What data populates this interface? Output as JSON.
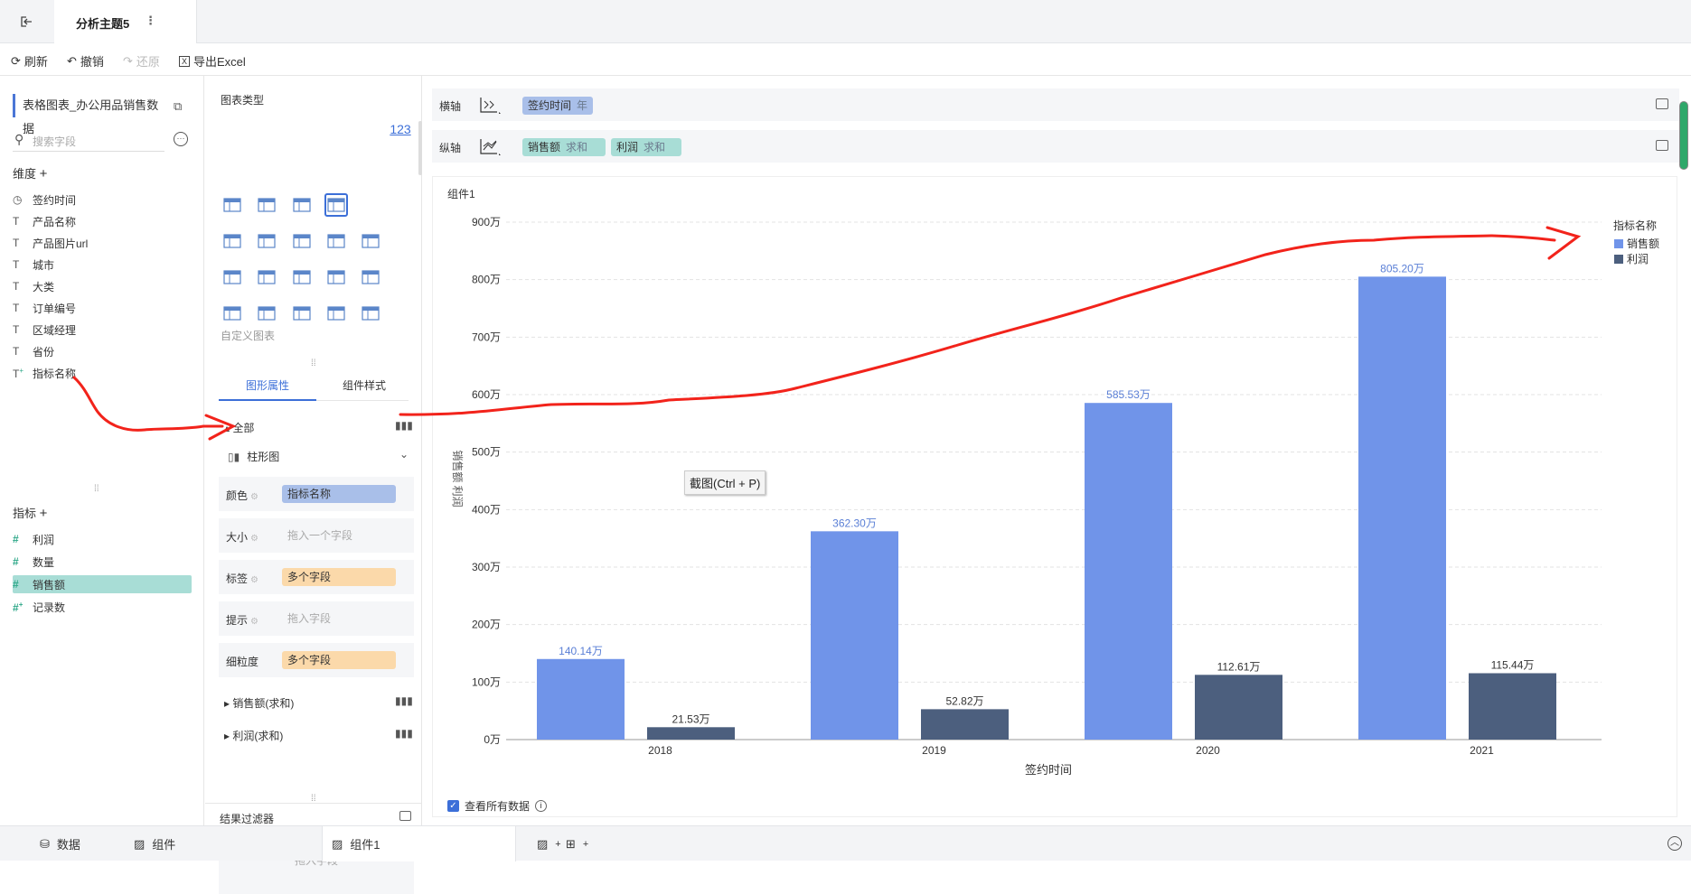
{
  "titlebar": {
    "tab_title": "分析主题5",
    "more": "⋮"
  },
  "toolbar": {
    "refresh": "刷新",
    "undo": "撤销",
    "redo": "还原",
    "export": "导出Excel"
  },
  "left": {
    "dataset": "表格图表_办公用品销售数据",
    "search_placeholder": "搜索字段",
    "dim_header": "维度",
    "dimensions": [
      "签约时间",
      "产品名称",
      "产品图片url",
      "城市",
      "大类",
      "订单编号",
      "区域经理",
      "省份",
      "指标名称"
    ],
    "measure_header": "指标",
    "measures": [
      "利润",
      "数量",
      "销售额",
      "记录数"
    ]
  },
  "mid": {
    "chart_type_label": "图表类型",
    "numeric_icon": "123",
    "custom_chart": "自定义图表",
    "tab_props": "图形属性",
    "tab_style": "组件样式",
    "all": "全部",
    "bar_type": "柱形图",
    "color_lbl": "颜色",
    "color_val": "指标名称",
    "size_lbl": "大小",
    "size_val": "拖入一个字段",
    "label_lbl": "标签",
    "label_val": "多个字段",
    "tip_lbl": "提示",
    "tip_val": "拖入字段",
    "gran_lbl": "细粒度",
    "gran_val": "多个字段",
    "exp1": "销售额(求和)",
    "exp2": "利润(求和)",
    "filter_title": "结果过滤器",
    "filter_ph": "拖入字段"
  },
  "shelves": {
    "x_label": "横轴",
    "x_chip": "签约时间",
    "x_chip_agg": "年",
    "y_label": "纵轴",
    "y_chip1": "销售额",
    "y_chip1_agg": "求和",
    "y_chip2": "利润",
    "y_chip2_agg": "求和"
  },
  "component_title": "组件1",
  "view_all": "查看所有数据",
  "tooltip": "截图(Ctrl + P)",
  "bottom": {
    "data_tab": "数据",
    "comp_tab": "组件",
    "active_tab": "组件1"
  },
  "colors": {
    "sales": "#7094e9",
    "profit": "#4c5f7e",
    "accent": "#3c6fd8",
    "annotation": "#f2231b"
  },
  "chart_data": {
    "type": "bar",
    "categories": [
      "2018",
      "2019",
      "2020",
      "2021"
    ],
    "series": [
      {
        "name": "销售额",
        "values": [
          140.14,
          362.3,
          585.53,
          805.2
        ],
        "labels": [
          "140.14万",
          "362.30万",
          "585.53万",
          "805.20万"
        ]
      },
      {
        "name": "利润",
        "values": [
          21.53,
          52.82,
          112.61,
          115.44
        ],
        "labels": [
          "21.53万",
          "52.82万",
          "112.61万",
          "115.44万"
        ]
      }
    ],
    "xlabel": "签约时间",
    "ylabel": "销售额 利润",
    "ylim": [
      0,
      900
    ],
    "yticks": [
      "0万",
      "100万",
      "200万",
      "300万",
      "400万",
      "500万",
      "600万",
      "700万",
      "800万",
      "900万"
    ],
    "legend_title": "指标名称",
    "legend_position": "top-right",
    "grid": true
  }
}
